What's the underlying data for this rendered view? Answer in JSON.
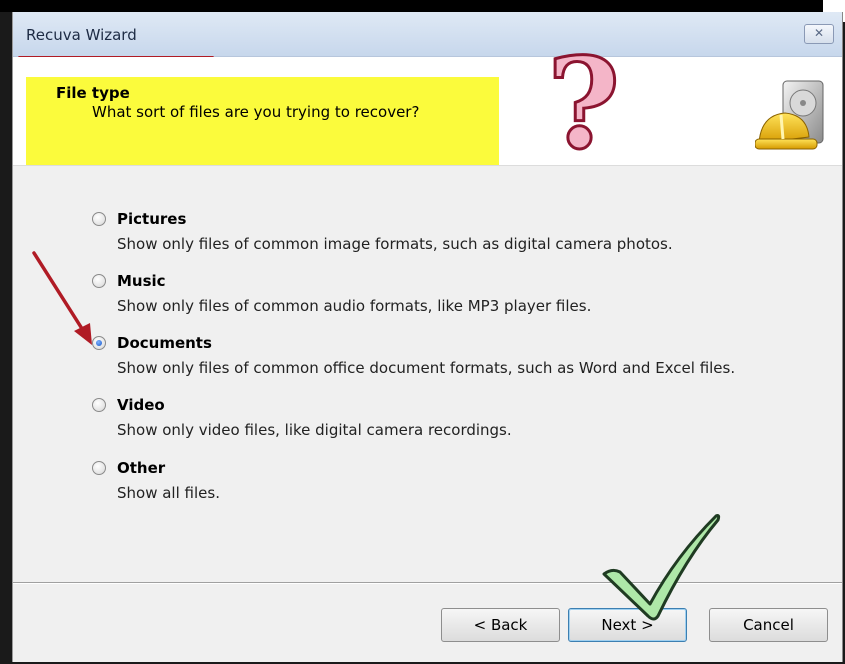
{
  "window": {
    "title": "Recuva Wizard",
    "close_label": "✕"
  },
  "header": {
    "title": "File type",
    "subtitle": "What sort of files are you trying to recover?",
    "question_mark": "?"
  },
  "options": [
    {
      "label": "Pictures",
      "desc": "Show only files of common image formats, such as digital camera photos.",
      "checked": false
    },
    {
      "label": "Music",
      "desc": "Show only files of common audio formats, like MP3 player files.",
      "checked": false
    },
    {
      "label": "Documents",
      "desc": "Show only files of common office document formats, such as Word and Excel files.",
      "checked": true
    },
    {
      "label": "Video",
      "desc": "Show only video files, like digital camera recordings.",
      "checked": false
    },
    {
      "label": "Other",
      "desc": "Show all files.",
      "checked": false
    }
  ],
  "buttons": {
    "back": "< Back",
    "next": "Next >",
    "cancel": "Cancel"
  },
  "icons": {
    "header_icon": "hard-drive-hardhat-icon",
    "annotation_arrow": "red-arrow-icon",
    "annotation_check": "green-checkmark-icon"
  },
  "colors": {
    "highlight": "#fbfb3c",
    "annotation_red": "#b01b25",
    "check_green": "#aee8a8"
  }
}
